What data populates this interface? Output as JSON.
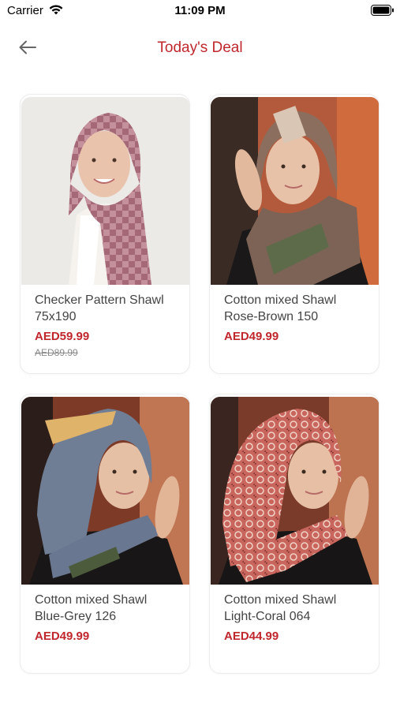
{
  "status": {
    "carrier": "Carrier",
    "time": "11:09 PM"
  },
  "header": {
    "title": "Today's Deal"
  },
  "products": [
    {
      "title_line1": "Checker Pattern Shawl",
      "title_line2": "75x190",
      "price": "AED59.99",
      "old_price": "AED89.99"
    },
    {
      "title_line1": "Cotton mixed Shawl",
      "title_line2": "Rose-Brown 150",
      "price": "AED49.99"
    },
    {
      "title_line1": "Cotton mixed Shawl",
      "title_line2": "Blue-Grey 126",
      "price": "AED49.99"
    },
    {
      "title_line1": "Cotton mixed Shawl",
      "title_line2": "Light-Coral 064",
      "price": "AED44.99"
    }
  ],
  "colors": {
    "accent": "#c0272d",
    "text": "#444444",
    "strike": "#8a8a8a"
  },
  "icons": {
    "back": "arrow-left-icon",
    "wifi": "wifi-icon",
    "battery": "battery-icon"
  }
}
